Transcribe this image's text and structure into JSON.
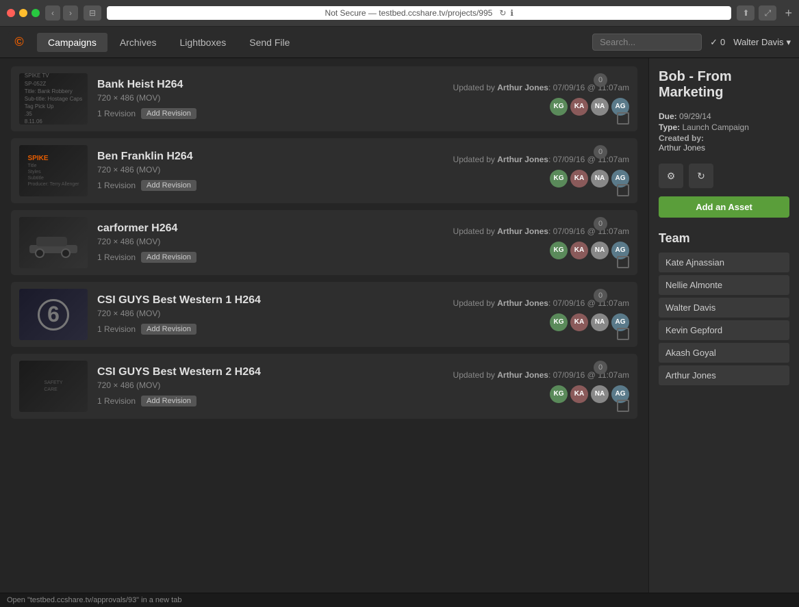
{
  "browser": {
    "url": "Not Secure — testbed.ccshare.tv/projects/995",
    "refresh_icon": "↻",
    "info_icon": "ℹ",
    "share_icon": "⬆",
    "expand_icon": "⤢",
    "new_tab_icon": "+"
  },
  "nav": {
    "logo_char": "©",
    "tabs": [
      {
        "label": "Campaigns",
        "active": true
      },
      {
        "label": "Archives",
        "active": false
      },
      {
        "label": "Lightboxes",
        "active": false
      },
      {
        "label": "Send File",
        "active": false
      }
    ],
    "search_placeholder": "Search...",
    "notification_label": "0",
    "user_label": "Walter Davis",
    "notification_icon": "✓"
  },
  "assets": [
    {
      "title": "Bank Heist H264",
      "dims": "720 × 486 (MOV)",
      "updated_text": "Updated by",
      "updated_by": "Arthur Jones",
      "updated_at": ": 07/09/16 @ 11:07am",
      "revisions": "1 Revision",
      "add_revision": "Add Revision",
      "badge": "0",
      "avatars": [
        {
          "initials": "KG",
          "class": "av-kg"
        },
        {
          "initials": "KA",
          "class": "av-ka"
        },
        {
          "initials": "NA",
          "class": "av-na"
        },
        {
          "initials": "AG",
          "class": "av-ag"
        }
      ],
      "thumb_class": "thumb-bank",
      "thumb_lines": [
        "SPIKE TV",
        "SP-052Z",
        "Title: Bank Robbery",
        "Sub-title: Hostage Caps",
        "Tag Pick Up",
        ".35",
        "8.11.06"
      ]
    },
    {
      "title": "Ben Franklin H264",
      "dims": "720 × 486 (MOV)",
      "updated_text": "Updated by",
      "updated_by": "Arthur Jones",
      "updated_at": ": 07/09/16 @ 11:07am",
      "revisions": "1 Revision",
      "add_revision": "Add Revision",
      "badge": "0",
      "avatars": [
        {
          "initials": "KG",
          "class": "av-kg"
        },
        {
          "initials": "KA",
          "class": "av-ka"
        },
        {
          "initials": "NA",
          "class": "av-na"
        },
        {
          "initials": "AG",
          "class": "av-ag"
        }
      ],
      "thumb_class": "thumb-franklin",
      "thumb_lines": [
        "SPIKE",
        "Title",
        "Styles",
        "Subtitle",
        "Producer: Terry Allenger"
      ]
    },
    {
      "title": "carformer H264",
      "dims": "720 × 486 (MOV)",
      "updated_text": "Updated by",
      "updated_by": "Arthur Jones",
      "updated_at": ": 07/09/16 @ 11:07am",
      "revisions": "1 Revision",
      "add_revision": "Add Revision",
      "badge": "0",
      "avatars": [
        {
          "initials": "KG",
          "class": "av-kg"
        },
        {
          "initials": "KA",
          "class": "av-ka"
        },
        {
          "initials": "NA",
          "class": "av-na"
        },
        {
          "initials": "AG",
          "class": "av-ag"
        }
      ],
      "thumb_class": "thumb-carformer",
      "thumb_lines": [
        "car image"
      ]
    },
    {
      "title": "CSI GUYS Best Western 1 H264",
      "dims": "720 × 486 (MOV)",
      "updated_text": "Updated by",
      "updated_by": "Arthur Jones",
      "updated_at": ": 07/09/16 @ 11:07am",
      "revisions": "1 Revision",
      "add_revision": "Add Revision",
      "badge": "0",
      "avatars": [
        {
          "initials": "KG",
          "class": "av-kg"
        },
        {
          "initials": "KA",
          "class": "av-ka"
        },
        {
          "initials": "NA",
          "class": "av-na"
        },
        {
          "initials": "AG",
          "class": "av-ag"
        }
      ],
      "thumb_class": "thumb-csi1",
      "thumb_lines": [
        "6"
      ]
    },
    {
      "title": "CSI GUYS Best Western 2 H264",
      "dims": "720 × 486 (MOV)",
      "updated_text": "Updated by",
      "updated_by": "Arthur Jones",
      "updated_at": ": 07/09/16 @ 11:07am",
      "revisions": "1 Revision",
      "add_revision": "Add Revision",
      "badge": "0",
      "avatars": [
        {
          "initials": "KG",
          "class": "av-kg"
        },
        {
          "initials": "KA",
          "class": "av-ka"
        },
        {
          "initials": "NA",
          "class": "av-na"
        },
        {
          "initials": "AG",
          "class": "av-ag"
        }
      ],
      "thumb_class": "thumb-csi2",
      "thumb_lines": []
    }
  ],
  "sidebar": {
    "project_title": "Bob - From Marketing",
    "due_label": "Due:",
    "due_value": "09/29/14",
    "type_label": "Type:",
    "type_value": "Launch Campaign",
    "created_label": "Created by:",
    "created_value": "Arthur Jones",
    "gear_icon": "⚙",
    "refresh_icon": "↻",
    "add_asset_label": "Add an Asset",
    "team_title": "Team",
    "team_members": [
      "Kate Ajnassian",
      "Nellie Almonte",
      "Walter Davis",
      "Kevin Gepford",
      "Akash Goyal",
      "Arthur Jones"
    ]
  },
  "status_bar": {
    "text": "Open \"testbed.ccshare.tv/approvals/93\" in a new tab"
  }
}
